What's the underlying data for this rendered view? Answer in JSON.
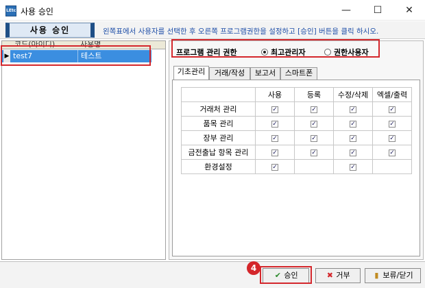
{
  "window": {
    "title": "사용 승인",
    "icon_label": "LEtc"
  },
  "header": {
    "page_button": "사용 승인",
    "instruction": "왼쪽표에서 사용자를 선택한 후 오른쪽 프로그램권한을 설정하고 [승인] 버튼을 클릭 하시오."
  },
  "user_grid": {
    "columns": [
      "코드(아이디)",
      "사용명"
    ],
    "rows": [
      {
        "code": "test7",
        "name": "테스트",
        "selected": true
      }
    ]
  },
  "authority": {
    "label": "프로그램 관리 권한",
    "options": [
      {
        "label": "최고관리자",
        "selected": true
      },
      {
        "label": "권한사용자",
        "selected": false
      }
    ]
  },
  "tabs": [
    {
      "label": "기초관리",
      "active": true
    },
    {
      "label": "거래/작성",
      "active": false
    },
    {
      "label": "보고서",
      "active": false
    },
    {
      "label": "스마트폰",
      "active": false
    }
  ],
  "permissions": {
    "columns": [
      "사용",
      "등록",
      "수정/삭제",
      "엑셀/출력"
    ],
    "rows": [
      {
        "label": "거래처 관리",
        "checks": [
          true,
          true,
          true,
          true
        ]
      },
      {
        "label": "품목 관리",
        "checks": [
          true,
          true,
          true,
          true
        ]
      },
      {
        "label": "장부 관리",
        "checks": [
          true,
          true,
          true,
          true
        ]
      },
      {
        "label": "금전출납 항목 관리",
        "checks": [
          true,
          true,
          true,
          true
        ]
      },
      {
        "label": "환경설정",
        "checks": [
          true,
          null,
          true,
          null
        ]
      }
    ]
  },
  "footer": {
    "step_badge": "4",
    "approve_label": "승인",
    "reject_label": "거부",
    "hold_close_label": "보류/닫기"
  },
  "colors": {
    "highlight_red": "#d4262b",
    "selection_blue": "#3b8ee0",
    "instruction_blue": "#1f4fa8"
  }
}
